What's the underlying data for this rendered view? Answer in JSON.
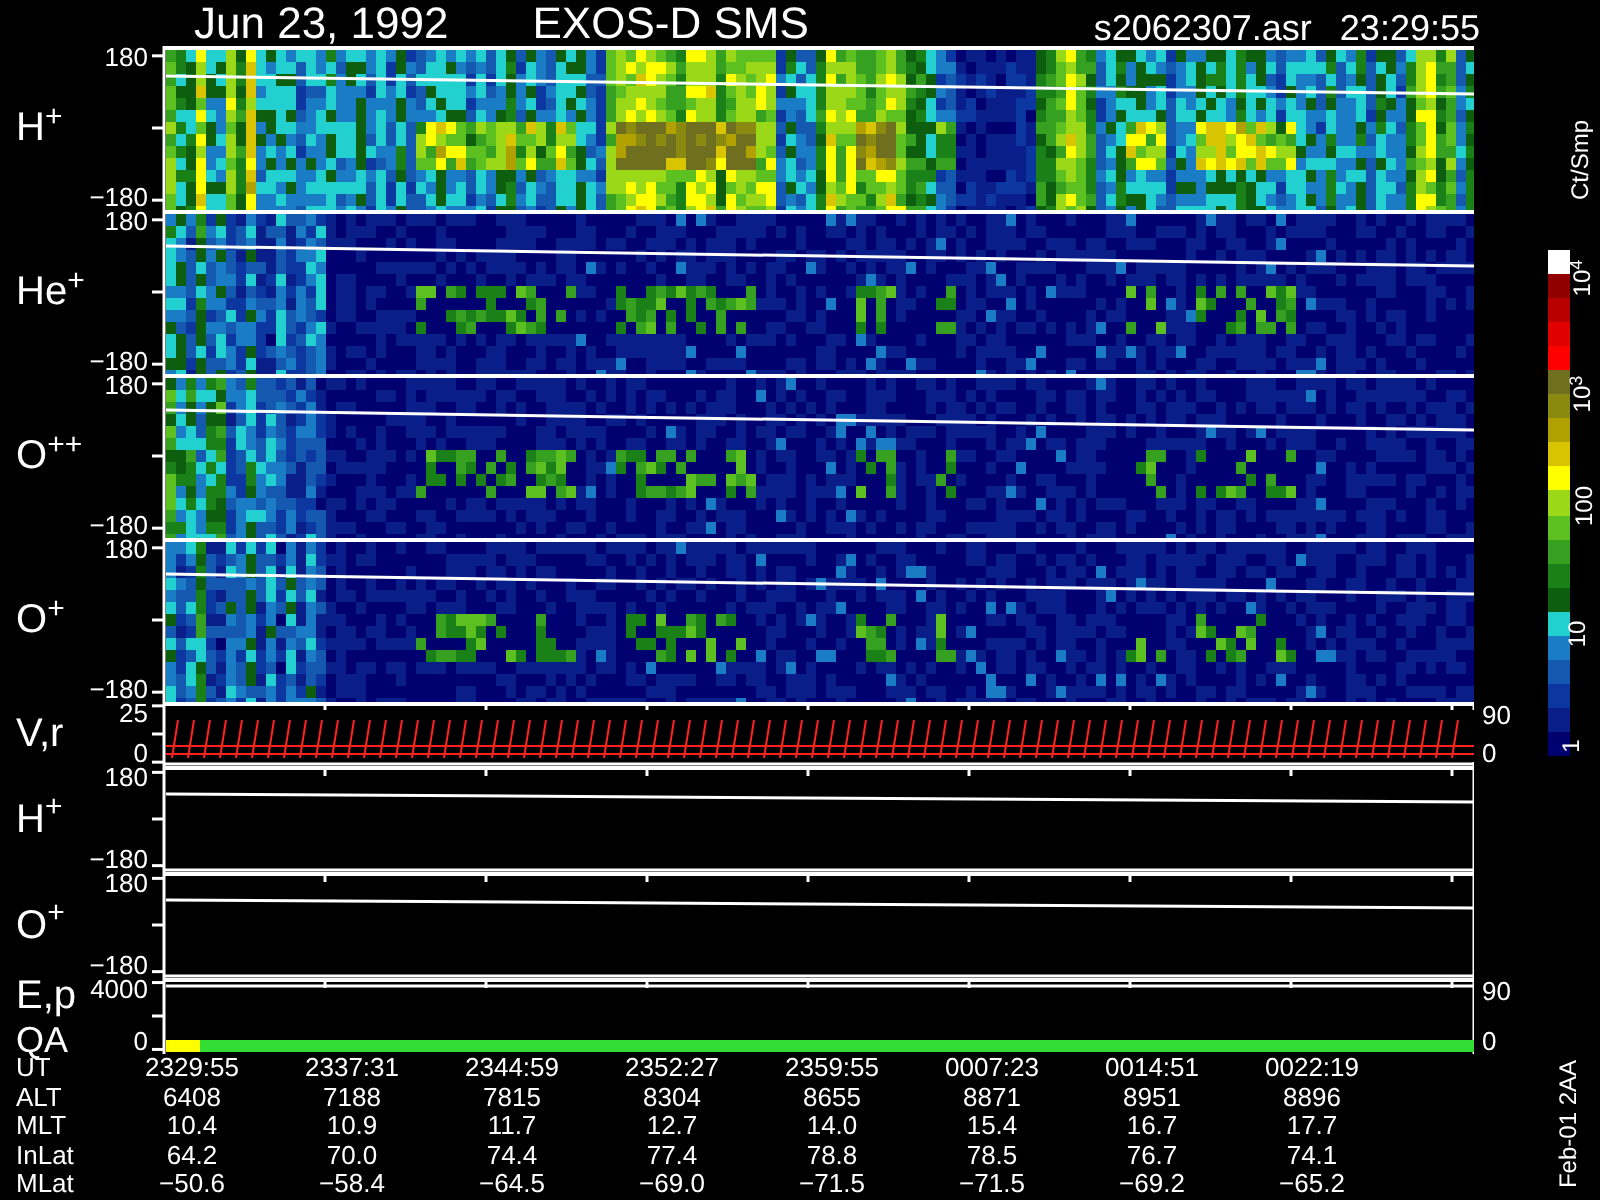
{
  "header": {
    "date": "Jun 23, 1992",
    "title": "EXOS-D SMS",
    "file": "s2062307.asr",
    "time": "23:29:55"
  },
  "panels": [
    {
      "kind": "spectrogram",
      "label": "H$^{+}$",
      "ticks": [
        "180",
        "−180"
      ]
    },
    {
      "kind": "spectrogram",
      "label": "He$^{+}$",
      "ticks": [
        "180",
        "−180"
      ]
    },
    {
      "kind": "spectrogram",
      "label": "O$^{++}$",
      "ticks": [
        "180",
        "−180"
      ]
    },
    {
      "kind": "spectrogram",
      "label": "O$^{+}$",
      "ticks": [
        "180",
        "−180"
      ]
    },
    {
      "kind": "velocity",
      "label": "V,r",
      "ticks": [
        "25",
        "0"
      ],
      "right_ticks": [
        "90",
        "0"
      ]
    },
    {
      "kind": "trace",
      "label": "H$^{+}$",
      "ticks": [
        "180",
        "−180"
      ]
    },
    {
      "kind": "trace",
      "label": "O$^{+}$",
      "ticks": [
        "180",
        "−180"
      ]
    },
    {
      "kind": "energy",
      "label": "E,p",
      "label_2": "QA",
      "ticks": [
        "4000",
        "0"
      ],
      "right_ticks": [
        "90",
        "0"
      ]
    }
  ],
  "colorbar": {
    "unit": "Ct/Smp",
    "ticks": [
      "10$^{4}$",
      "10$^{3}$",
      "100",
      "10",
      "1"
    ]
  },
  "table": [
    {
      "label": "UT",
      "values": [
        "2329:55",
        "2337:31",
        "2344:59",
        "2352:27",
        "2359:55",
        "0007:23",
        "0014:51",
        "0022:19"
      ]
    },
    {
      "label": "ALT",
      "values": [
        "6408",
        "7188",
        "7815",
        "8304",
        "8655",
        "8871",
        "8951",
        "8896"
      ]
    },
    {
      "label": "MLT",
      "values": [
        "10.4",
        "10.9",
        "11.7",
        "12.7",
        "14.0",
        "15.4",
        "16.7",
        "17.7"
      ]
    },
    {
      "label": "InLat",
      "values": [
        "64.2",
        "70.0",
        "74.4",
        "77.4",
        "78.8",
        "78.5",
        "76.7",
        "74.1"
      ]
    },
    {
      "label": "MLat",
      "values": [
        "−50.6",
        "−58.4",
        "−64.5",
        "−69.0",
        "−71.5",
        "−71.5",
        "−69.2",
        "−65.2"
      ]
    }
  ],
  "stamp": "Feb-01 2AA"
}
